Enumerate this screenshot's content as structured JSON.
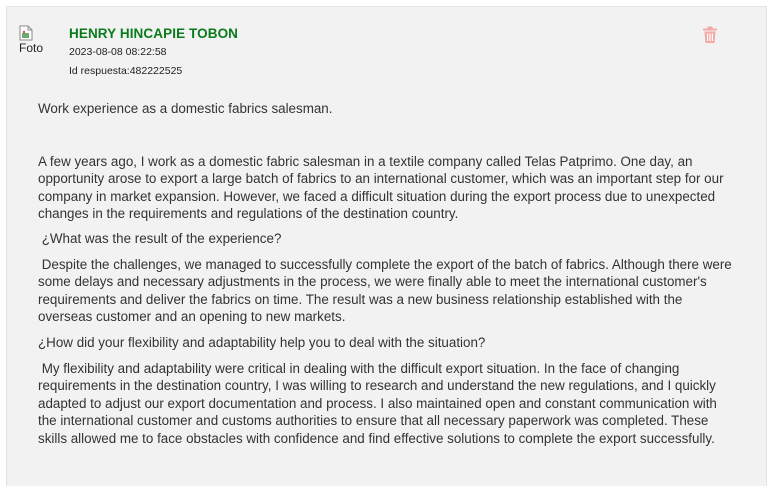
{
  "answer": {
    "avatar_alt": "Foto",
    "author": "HENRY HINCAPIE TOBON",
    "date": "2023-08-08 08:22:58",
    "response_id": "Id respuesta:482222525",
    "paragraphs": [
      "Work experience as a domestic fabrics salesman.",
      "A few years ago, I work as a domestic fabric salesman in a textile company called Telas Patprimo. One day, an opportunity arose to export a large batch of fabrics to an international customer, which was an important step for our company in market expansion. However, we faced a difficult situation during the export process due to unexpected changes in the requirements and regulations of the destination country.",
      " ¿What was the result of the experience?",
      " Despite the challenges, we managed to successfully complete the export of the batch of fabrics. Although there were some delays and necessary adjustments in the process, we were finally able to meet the international customer's requirements and deliver the fabrics on time. The result was a new business relationship established with the overseas customer and an opening to new markets.",
      "¿How did your flexibility and adaptability help you to deal with the situation?",
      " My flexibility and adaptability were critical in dealing with the difficult export situation. In the face of changing requirements in the destination country, I was willing to research and understand the new regulations, and I quickly adapted to adjust our export documentation and process. I also maintained open and constant communication with the international customer and customs authorities to ensure that all necessary paperwork was completed. These skills allowed me to face obstacles with confidence and find effective solutions to complete the export successfully."
    ]
  },
  "colors": {
    "author": "#0a7a1a",
    "trash_icon": "#f3a9a9",
    "panel_bg": "#f2f2f2"
  },
  "icons": {
    "avatar": "broken-image-icon",
    "delete": "trash-icon"
  }
}
